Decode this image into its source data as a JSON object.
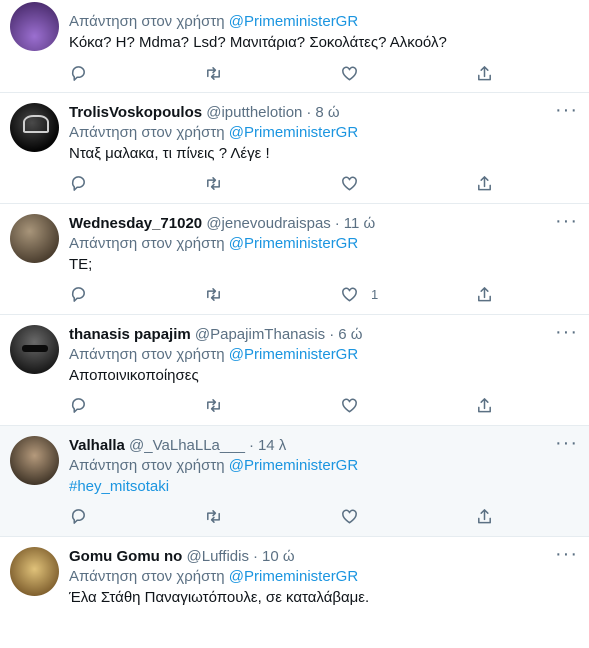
{
  "tweets": [
    {
      "name": "",
      "handle": "",
      "time": "",
      "reply_prefix": "Απάντηση στον χρήστη",
      "reply_mention": "@PrimeministerGR",
      "text": "Κόκα? Η? Mdma? Lsd? Μανιτάρια? Σοκολάτες?  Αλκοόλ?",
      "likes": "",
      "avatar_color": "#5a3a7a"
    },
    {
      "name": "TrolisVoskopoulos",
      "handle": "@iputthelotion",
      "time": "8 ώ",
      "reply_prefix": "Απάντηση στον χρήστη",
      "reply_mention": "@PrimeministerGR",
      "text": "Νταξ μαλακα, τι πίνεις ? Λέγε !",
      "likes": "",
      "avatar_color": "#111111"
    },
    {
      "name": "Wednesday_71020",
      "handle": "@jenevoudraispas",
      "time": "11 ώ",
      "reply_prefix": "Απάντηση στον χρήστη",
      "reply_mention": "@PrimeministerGR",
      "text": "ΤΕ;",
      "likes": "1",
      "avatar_color": "#7a6a55"
    },
    {
      "name": "thanasis papajim",
      "handle": "@PapajimThanasis",
      "time": "6 ώ",
      "reply_prefix": "Απάντηση στον χρήστη",
      "reply_mention": "@PrimeministerGR",
      "text": "Αποποινικοποίησες",
      "likes": "",
      "avatar_color": "#3b3b3b"
    },
    {
      "name": "Valhalla",
      "handle": "@_VaLhaLLa___",
      "time": "14 λ",
      "reply_prefix": "Απάντηση στον χρήστη",
      "reply_mention": "@PrimeministerGR",
      "text": "#hey_mitsotaki",
      "likes": "",
      "avatar_color": "#6b5a45"
    },
    {
      "name": "Gomu Gomu no",
      "handle": "@Luffidis",
      "time": "10 ώ",
      "reply_prefix": "Απάντηση στον χρήστη",
      "reply_mention": "@PrimeministerGR",
      "text": "Έλα Στάθη Παναγιωτόπουλε, σε καταλάβαμε.",
      "likes": "",
      "avatar_color": "#b08a45"
    }
  ],
  "icons": {
    "reply": "reply-icon",
    "retweet": "retweet-icon",
    "like": "like-icon",
    "share": "share-icon",
    "more": "more-icon"
  },
  "colors": {
    "link": "#1b95e0",
    "secondary": "#5b7083",
    "highlight_bg": "#f5f8fa",
    "divider": "#e6ecf0"
  }
}
